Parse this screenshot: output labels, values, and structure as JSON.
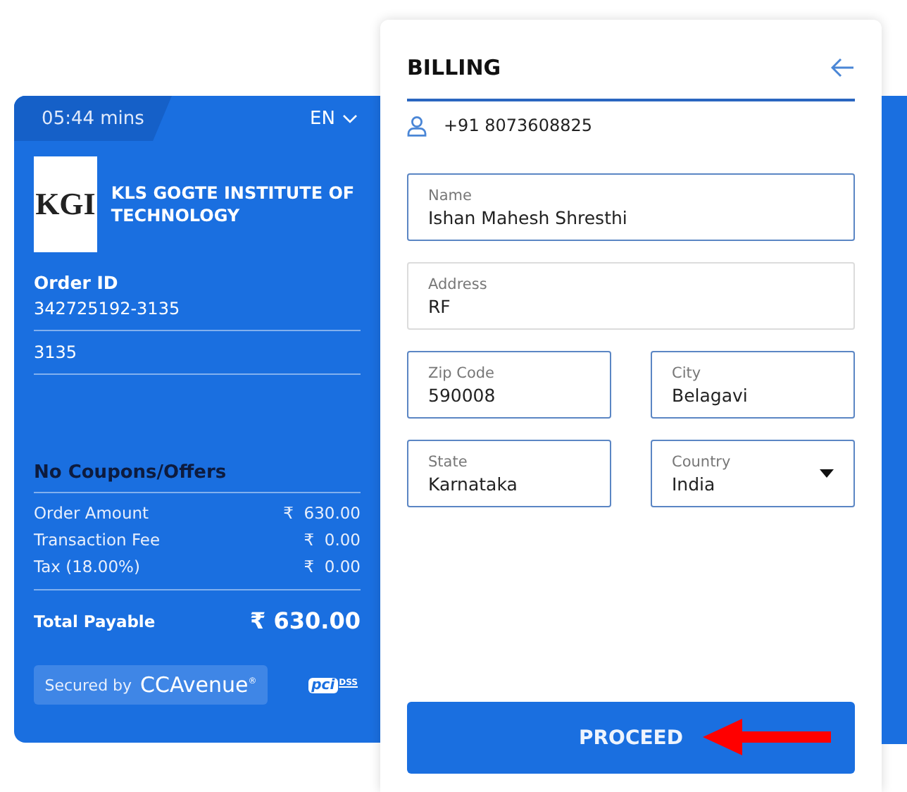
{
  "summary": {
    "timer": "05:44 mins",
    "language": "EN",
    "merchant": {
      "logo_text": "KGI",
      "name": "KLS GOGTE INSTITUTE OF TECHNOLOGY"
    },
    "order_id_label": "Order ID",
    "order_id": "342725192-3135",
    "reference": "3135",
    "coupons": "No Coupons/Offers",
    "lines": [
      {
        "label": "Order Amount",
        "currency": "₹",
        "amount": "630.00"
      },
      {
        "label": "Transaction Fee",
        "currency": "₹",
        "amount": "0.00"
      },
      {
        "label": "Tax (18.00%)",
        "currency": "₹",
        "amount": "0.00"
      }
    ],
    "total": {
      "label": "Total Payable",
      "currency": "₹",
      "amount": "630.00"
    },
    "secured": {
      "prefix": "Secured by",
      "brand": "CCAvenue",
      "mark": "®"
    },
    "pci": {
      "mark": "pci",
      "standard": "DSS"
    }
  },
  "billing": {
    "title": "BILLING",
    "phone": "+91 8073608825",
    "fields": [
      {
        "label": "Name",
        "value": "Ishan Mahesh Shresthi",
        "kind": "text",
        "highlighted": true,
        "wide": true
      },
      {
        "label": "Address",
        "value": "RF",
        "kind": "text",
        "highlighted": false,
        "wide": true
      },
      {
        "label": "Zip Code",
        "value": "590008",
        "kind": "text",
        "highlighted": true,
        "wide": false
      },
      {
        "label": "City",
        "value": "Belagavi",
        "kind": "text",
        "highlighted": true,
        "wide": false
      },
      {
        "label": "State",
        "value": "Karnataka",
        "kind": "text",
        "highlighted": true,
        "wide": false
      },
      {
        "label": "Country",
        "value": "India",
        "kind": "select",
        "highlighted": true,
        "wide": false
      }
    ],
    "proceed": "PROCEED"
  }
}
